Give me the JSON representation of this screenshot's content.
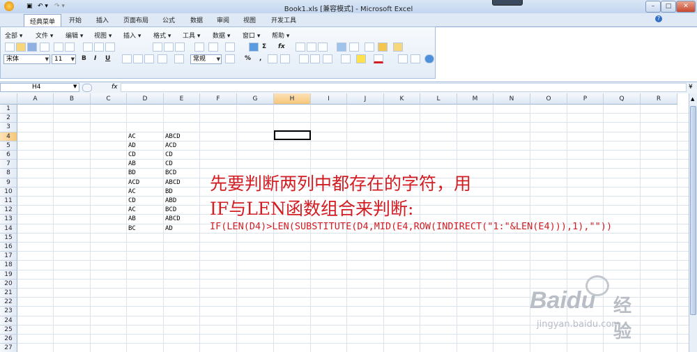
{
  "window": {
    "title": "Book1.xls  [兼容模式] - Microsoft Excel",
    "qat": [
      "▣",
      "↶ ▾",
      "↷ ▾"
    ],
    "controls": [
      "–",
      "□",
      "✕"
    ]
  },
  "ribbon": {
    "tabs": [
      "经典菜单",
      "开始",
      "插入",
      "页面布局",
      "公式",
      "数据",
      "审阅",
      "视图",
      "开发工具"
    ],
    "active_tab": "经典菜单",
    "menus": [
      "全部 ▾",
      "文件 ▾",
      "编辑 ▾",
      "视图 ▾",
      "插入 ▾",
      "格式 ▾",
      "工具 ▾",
      "数据 ▾",
      "窗口 ▾",
      "帮助 ▾"
    ],
    "font_name": "宋体",
    "font_size": "11",
    "bold": "B",
    "italic": "I",
    "underline": "U",
    "number_format": "常规",
    "percent": "%",
    "comma": ",",
    "sigma": "Σ",
    "fx": "fx"
  },
  "formula_bar": {
    "name_box": "H4",
    "fx_label": "fx",
    "content": ""
  },
  "grid": {
    "columns": [
      "A",
      "B",
      "C",
      "D",
      "E",
      "F",
      "G",
      "H",
      "I",
      "J",
      "K",
      "L",
      "M",
      "N",
      "O",
      "P",
      "Q",
      "R"
    ],
    "active_column": "H",
    "rows": [
      "1",
      "2",
      "3",
      "4",
      "5",
      "6",
      "7",
      "8",
      "9",
      "10",
      "11",
      "12",
      "13",
      "14",
      "15",
      "16",
      "17",
      "18",
      "19",
      "20",
      "21",
      "22",
      "23",
      "24",
      "25",
      "26",
      "27"
    ],
    "active_row": "4",
    "selected_cell": "H4"
  },
  "cells": {
    "D": [
      "AC",
      "AD",
      "CD",
      "AB",
      "BD",
      "ACD",
      "AC",
      "CD",
      "AC",
      "AB",
      "BC"
    ],
    "E": [
      "ABCD",
      "ACD",
      "CD",
      "CD",
      "BCD",
      "ABCD",
      "BD",
      "ABD",
      "BCD",
      "ABCD",
      "AD"
    ]
  },
  "annotation": {
    "line1": "先要判断两列中都存在的字符，用",
    "line2": "IF与LEN函数组合来判断:",
    "formula": "IF(LEN(D4)>LEN(SUBSTITUTE(D4,MID(E4,ROW(INDIRECT(\"1:\"&LEN(E4))),1),\"\"))",
    "color": "#d21d22"
  },
  "watermark": {
    "brand": "Baidu",
    "brand_cn": "经验",
    "url": "jingyan.baidu.com"
  }
}
